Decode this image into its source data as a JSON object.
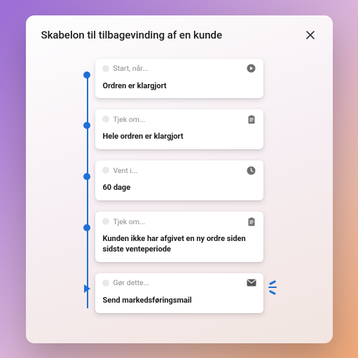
{
  "header": {
    "title": "Skabelon til tilbagevinding af en kunde"
  },
  "steps": [
    {
      "label": "Start, når...",
      "body": "Ordren er klargjort",
      "icon": "play-circle",
      "dot": "circle"
    },
    {
      "label": "Tjek om...",
      "body": "Hele ordren er klargjort",
      "icon": "clipboard",
      "dot": "circle"
    },
    {
      "label": "Vent i...",
      "body": "60 dage",
      "icon": "clock",
      "dot": "circle"
    },
    {
      "label": "Tjek om...",
      "body": "Kunden ikke har afgivet en ny ordre siden sidste venteperiode",
      "icon": "clipboard",
      "dot": "circle"
    },
    {
      "label": "Gør dette...",
      "body": "Send markedsføringsmail",
      "icon": "mail",
      "dot": "play",
      "spark": true
    }
  ],
  "colors": {
    "accent": "#1f6fd6"
  }
}
